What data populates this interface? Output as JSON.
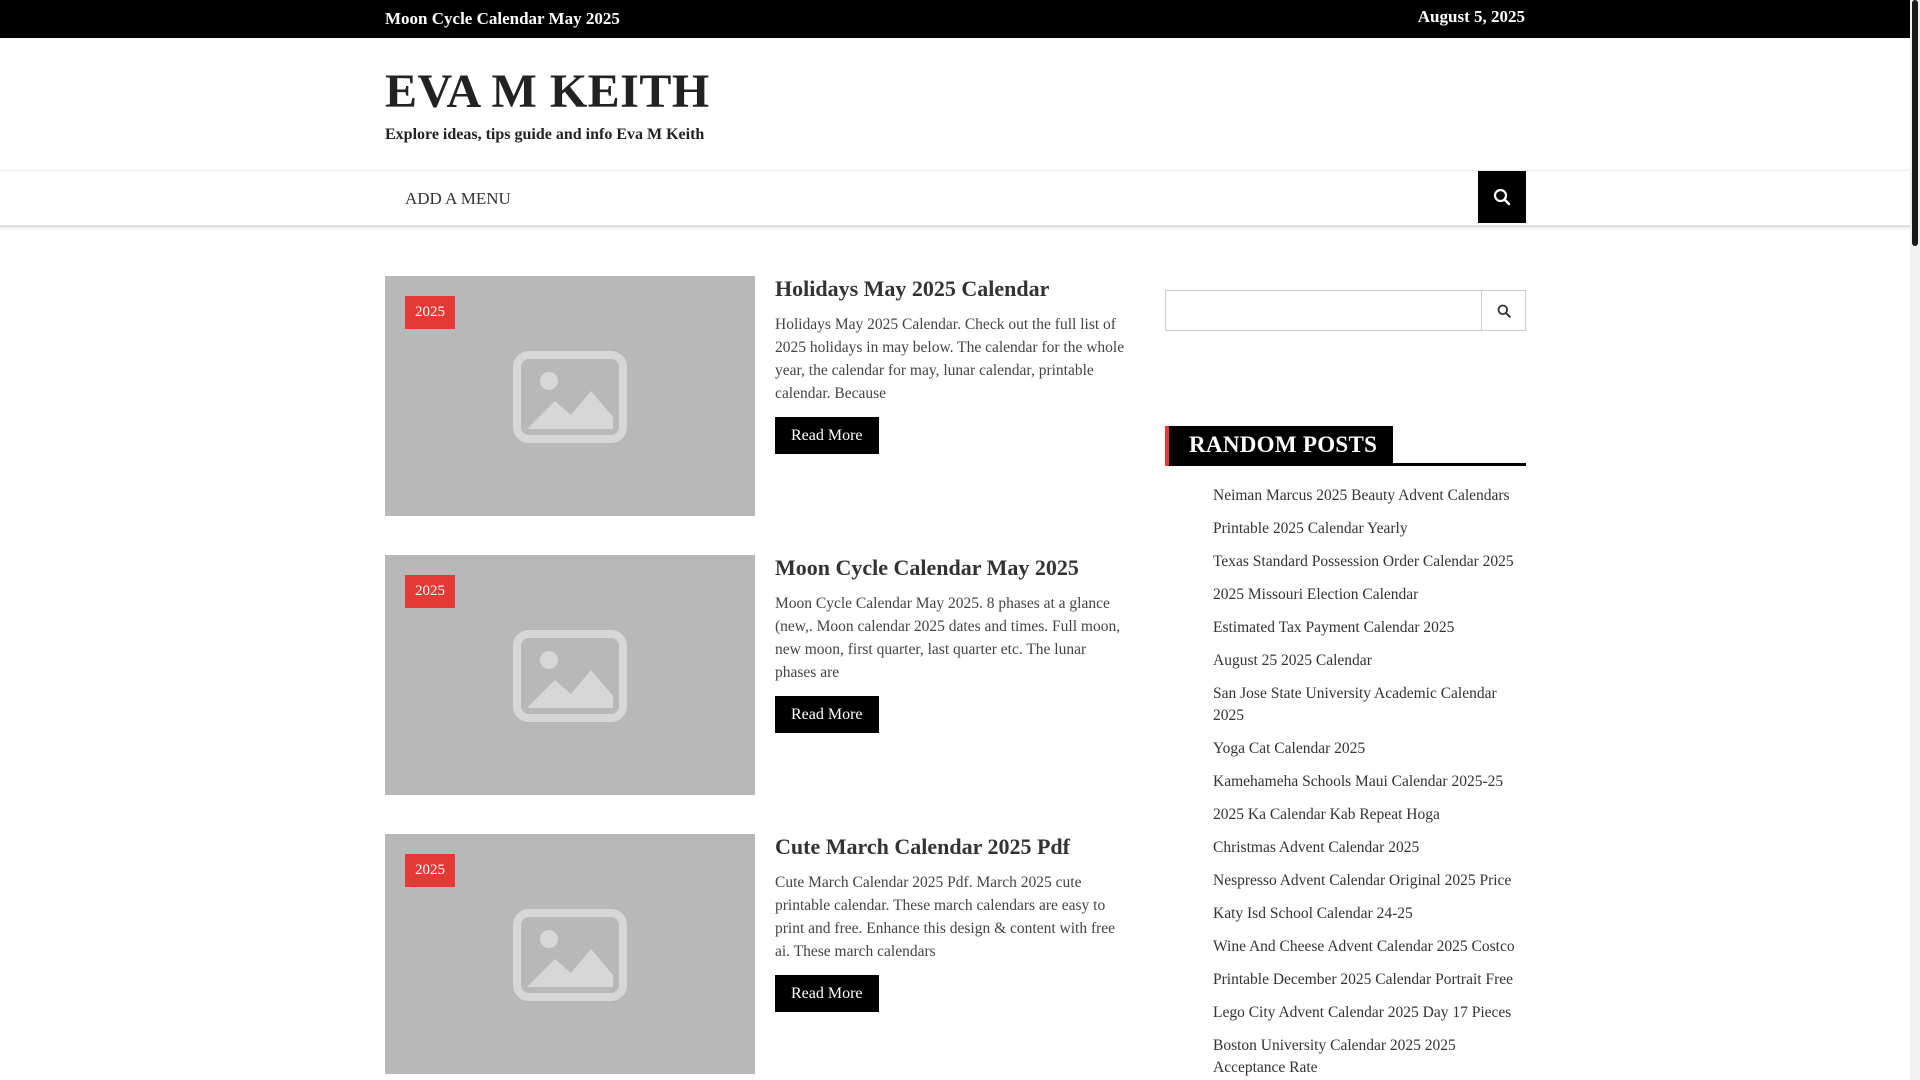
{
  "topbar": {
    "ticker": "Moon Cycle Calendar May 2025",
    "date": "August 5, 2025"
  },
  "site": {
    "title": "EVA M KEITH",
    "description": "Explore ideas, tips guide and info Eva M Keith"
  },
  "nav": {
    "menu_label": "ADD A MENU",
    "search_icon": "search-icon"
  },
  "posts": [
    {
      "category": "2025",
      "title": "Holidays May 2025 Calendar",
      "excerpt": "Holidays May 2025 Calendar. Check out the full list of 2025 holidays in may below. The calendar for the whole year, the calendar for may, lunar calendar, printable calendar. Because",
      "read_more": "Read More"
    },
    {
      "category": "2025",
      "title": "Moon Cycle Calendar May 2025",
      "excerpt": "Moon Cycle Calendar May 2025. 8 phases at a glance (new,. Moon calendar 2025 dates and times. Full moon, new moon, first quarter, last quarter etc. The lunar phases are",
      "read_more": "Read More"
    },
    {
      "category": "2025",
      "title": "Cute March Calendar 2025 Pdf",
      "excerpt": "Cute March Calendar 2025 Pdf. March 2025 cute printable calendar. These march calendars are easy to print and free. Enhance this design & content with free ai. These march calendars",
      "read_more": "Read More"
    }
  ],
  "sidebar": {
    "search_placeholder": "",
    "random_title": "RANDOM POSTS",
    "random_posts": [
      "Neiman Marcus 2025 Beauty Advent Calendars",
      "Printable 2025 Calendar Yearly",
      "Texas Standard Possession Order Calendar 2025",
      "2025 Missouri Election Calendar",
      "Estimated Tax Payment Calendar 2025",
      "August 25 2025 Calendar",
      "San Jose State University Academic Calendar 2025",
      "Yoga Cat Calendar 2025",
      "Kamehameha Schools Maui Calendar 2025-25",
      "2025 Ka Calendar Kab Repeat Hoga",
      "Christmas Advent Calendar 2025",
      "Nespresso Advent Calendar Original 2025 Price",
      "Katy Isd School Calendar 24-25",
      "Wine And Cheese Advent Calendar 2025 Costco",
      "Printable December 2025 Calendar Portrait Free",
      "Lego City Advent Calendar 2025 Day 17 Pieces",
      "Boston University Calendar 2025 2025 Acceptance Rate"
    ]
  },
  "colors": {
    "accent": "#e53935",
    "dark": "#000000",
    "placeholder_bg": "#b8b8b8"
  }
}
